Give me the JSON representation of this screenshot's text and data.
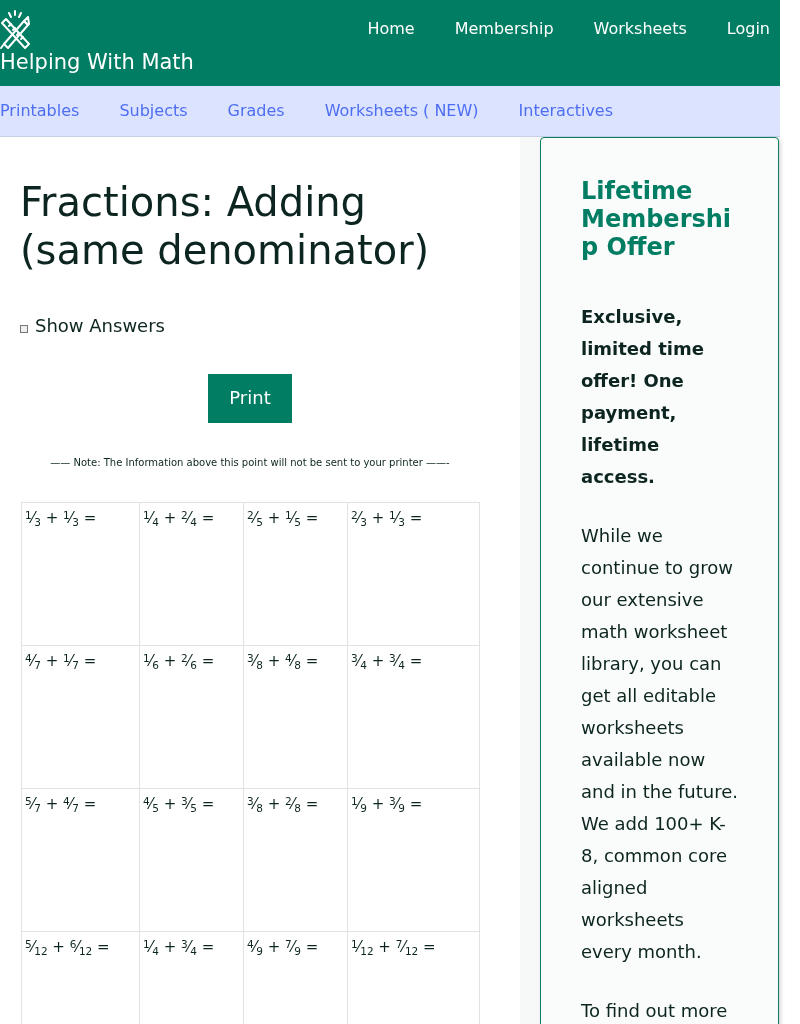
{
  "header": {
    "site_title": "Helping With Math",
    "nav": [
      "Home",
      "Membership",
      "Worksheets",
      "Login"
    ]
  },
  "subnav": [
    "Printables",
    "Subjects",
    "Grades",
    "Worksheets ( NEW)",
    "Interactives"
  ],
  "page": {
    "title": "Fractions: Adding (same denominator)",
    "show_answers": {
      "label": "Show Answers",
      "checked": false
    },
    "print_button": "Print",
    "note": "—— Note: The Information above this point will not be sent to your printer ——-"
  },
  "worksheet": {
    "rows": [
      [
        "$^{1}$⁄$_{3}$ + $^{1}$⁄$_{3}$ =",
        "$^{1}$⁄$_{4}$ + $^{2}$⁄$_{4}$ =",
        "$^{2}$⁄$_{5}$ + $^{1}$⁄$_{5}$ =",
        "$^{2}$⁄$_{3}$ + $^{1}$⁄$_{3}$ ="
      ],
      [
        "$^{4}$⁄$_{7}$ + $^{1}$⁄$_{7}$ =",
        "$^{1}$⁄$_{6}$ + $^{2}$⁄$_{6}$ =",
        "$^{3}$⁄$_{8}$ + $^{4}$⁄$_{8}$ =",
        "$^{3}$⁄$_{4}$ + $^{3}$⁄$_{4}$ ="
      ],
      [
        "$^{5}$⁄$_{7}$ + $^{4}$⁄$_{7}$ =",
        "$^{4}$⁄$_{5}$ + $^{3}$⁄$_{5}$ =",
        "$^{3}$⁄$_{8}$ + $^{2}$⁄$_{8}$ =",
        "$^{1}$⁄$_{9}$ + $^{3}$⁄$_{9}$ ="
      ],
      [
        "$^{5}$⁄$_{12}$ + $^{6}$⁄$_{12}$ =",
        "$^{1}$⁄$_{4}$ + $^{3}$⁄$_{4}$ =",
        "$^{4}$⁄$_{9}$ + $^{7}$⁄$_{9}$ =",
        "$^{1}$⁄$_{12}$ + $^{7}$⁄$_{12}$ ="
      ]
    ]
  },
  "sidebar": {
    "heading": "Lifetime Membership Offer",
    "paragraphs": [
      {
        "kind": "lead",
        "text": "Exclusive, limited time offer! One payment, lifetime access."
      },
      {
        "kind": "body",
        "text": "While we continue to grow our extensive math worksheet library, you can get all editable worksheets available now and in the future. We add 100+ K-8, common core aligned worksheets every month."
      },
      {
        "kind": "body",
        "text": "To find out more"
      }
    ]
  }
}
